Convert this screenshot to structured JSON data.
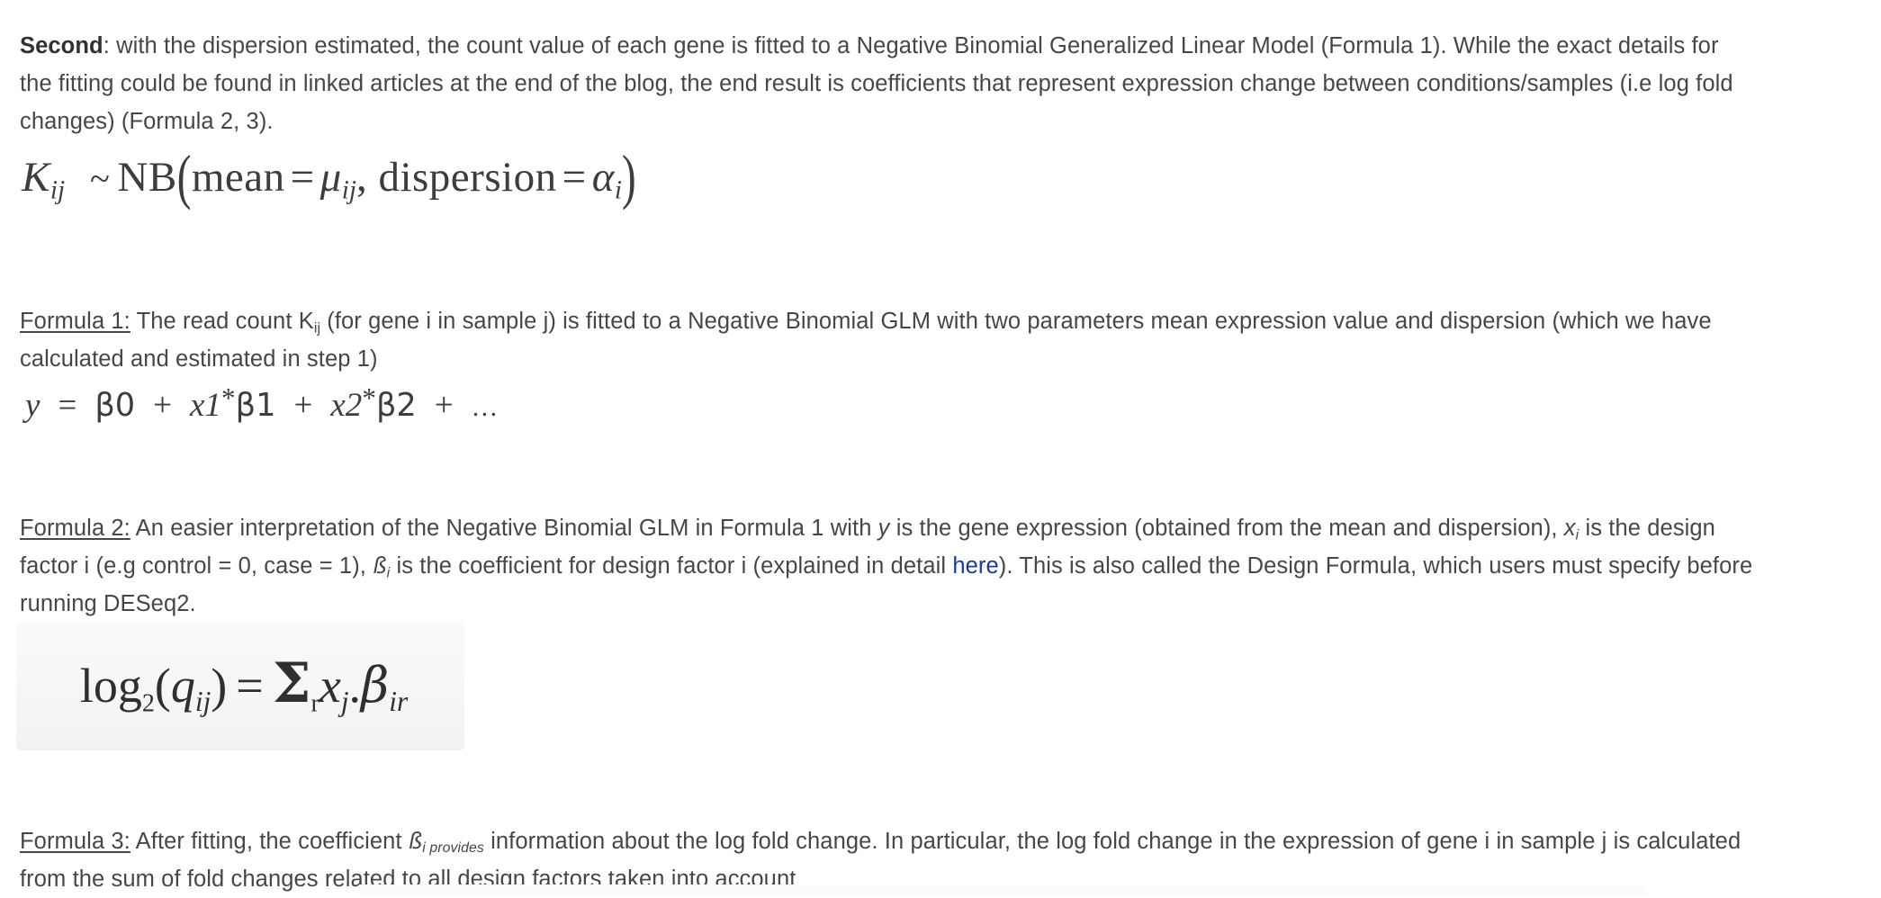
{
  "document": {
    "type": "blog-article-excerpt",
    "topic": "DESeq2 Negative Binomial GLM",
    "text_color": "#44474a",
    "link_color": "#1f3a93",
    "figure_background": "#f6f6f6"
  },
  "intro_paragraph": {
    "lead_label": "Second",
    "part_1": ": with the dispersion estimated, the count value of each gene is fitted to a Negative Binomial Generalized Linear Model (Formula 1). While the exact details for the fitting could be found in linked articles at the end of the blog, the end result is coefficients that represent expression change between conditions/samples (i.e log fold changes) (Formula 2, 3)."
  },
  "formula_1": {
    "equation": {
      "lhs_variable": "K",
      "lhs_subscript": "ij",
      "relation": "~",
      "distribution": "NB",
      "param_1_name": "mean",
      "param_1_value": "μ",
      "param_1_value_subscript": "ij",
      "param_2_name": "dispersion",
      "param_2_value": "α",
      "param_2_value_subscript": "i",
      "plain_text": "K_ij ~ NB(mean = μ_ij, dispersion = α_i)"
    },
    "caption_label": "Formula 1:",
    "caption_part_1": " The read count K",
    "caption_subscript": "ij",
    "caption_part_2": " (for gene i in sample j) is fitted to a Negative Binomial GLM with two parameters mean expression value and dispersion (which we have calculated and estimated in step 1)"
  },
  "formula_2": {
    "equation": {
      "plain_text": "y = β0 + x1 * β1 + x2 * β2 + …",
      "lhs": "y",
      "equals": "=",
      "terms": [
        "β0",
        "x1 * β1",
        "x2 * β2"
      ],
      "intercept": "β0",
      "x1": "x1",
      "b1": "β1",
      "x2": "x2",
      "b2": "β2",
      "plus": "+",
      "star": "*",
      "ellipsis": "…"
    },
    "caption_label": "Formula 2:",
    "caption_part_1": " An easier interpretation of the Negative Binomial GLM in Formula 1 with ",
    "caption_var_y": "y",
    "caption_part_2": " is the gene expression (obtained from the mean and dispersion), ",
    "caption_var_x": "x",
    "caption_var_x_subscript": "i",
    "caption_part_3": " is the design factor i (e.g control = 0, case = 1),  ",
    "caption_var_beta": "ß",
    "caption_var_beta_subscript": "i",
    "caption_part_4": " is the coefficient for design factor i (explained in detail ",
    "caption_link_text": "here",
    "caption_part_5": "). This is also called the Design Formula, which users must specify before running DESeq2."
  },
  "formula_3": {
    "equation": {
      "plain_text": "log2(q_ij) = Σ_r x_j.β_ir",
      "log_base": "2",
      "log_label": "log",
      "lhs_variable": "q",
      "lhs_subscript": "ij",
      "equals": "=",
      "summation": "Σ",
      "summation_subscript": "r",
      "x_variable": "x",
      "x_subscript": "j",
      "beta_variable": "β",
      "beta_subscript": "ir"
    },
    "caption_label": "Formula 3:",
    "caption_part_1": " After fitting, the coefficient ",
    "caption_var_beta": "ß",
    "caption_var_beta_subscript": "i provides",
    "caption_part_2": " information about the log fold change. In particular, the log fold change in the expression of gene i in sample j  is calculated from the sum of fold changes related to all design factors taken into account"
  }
}
